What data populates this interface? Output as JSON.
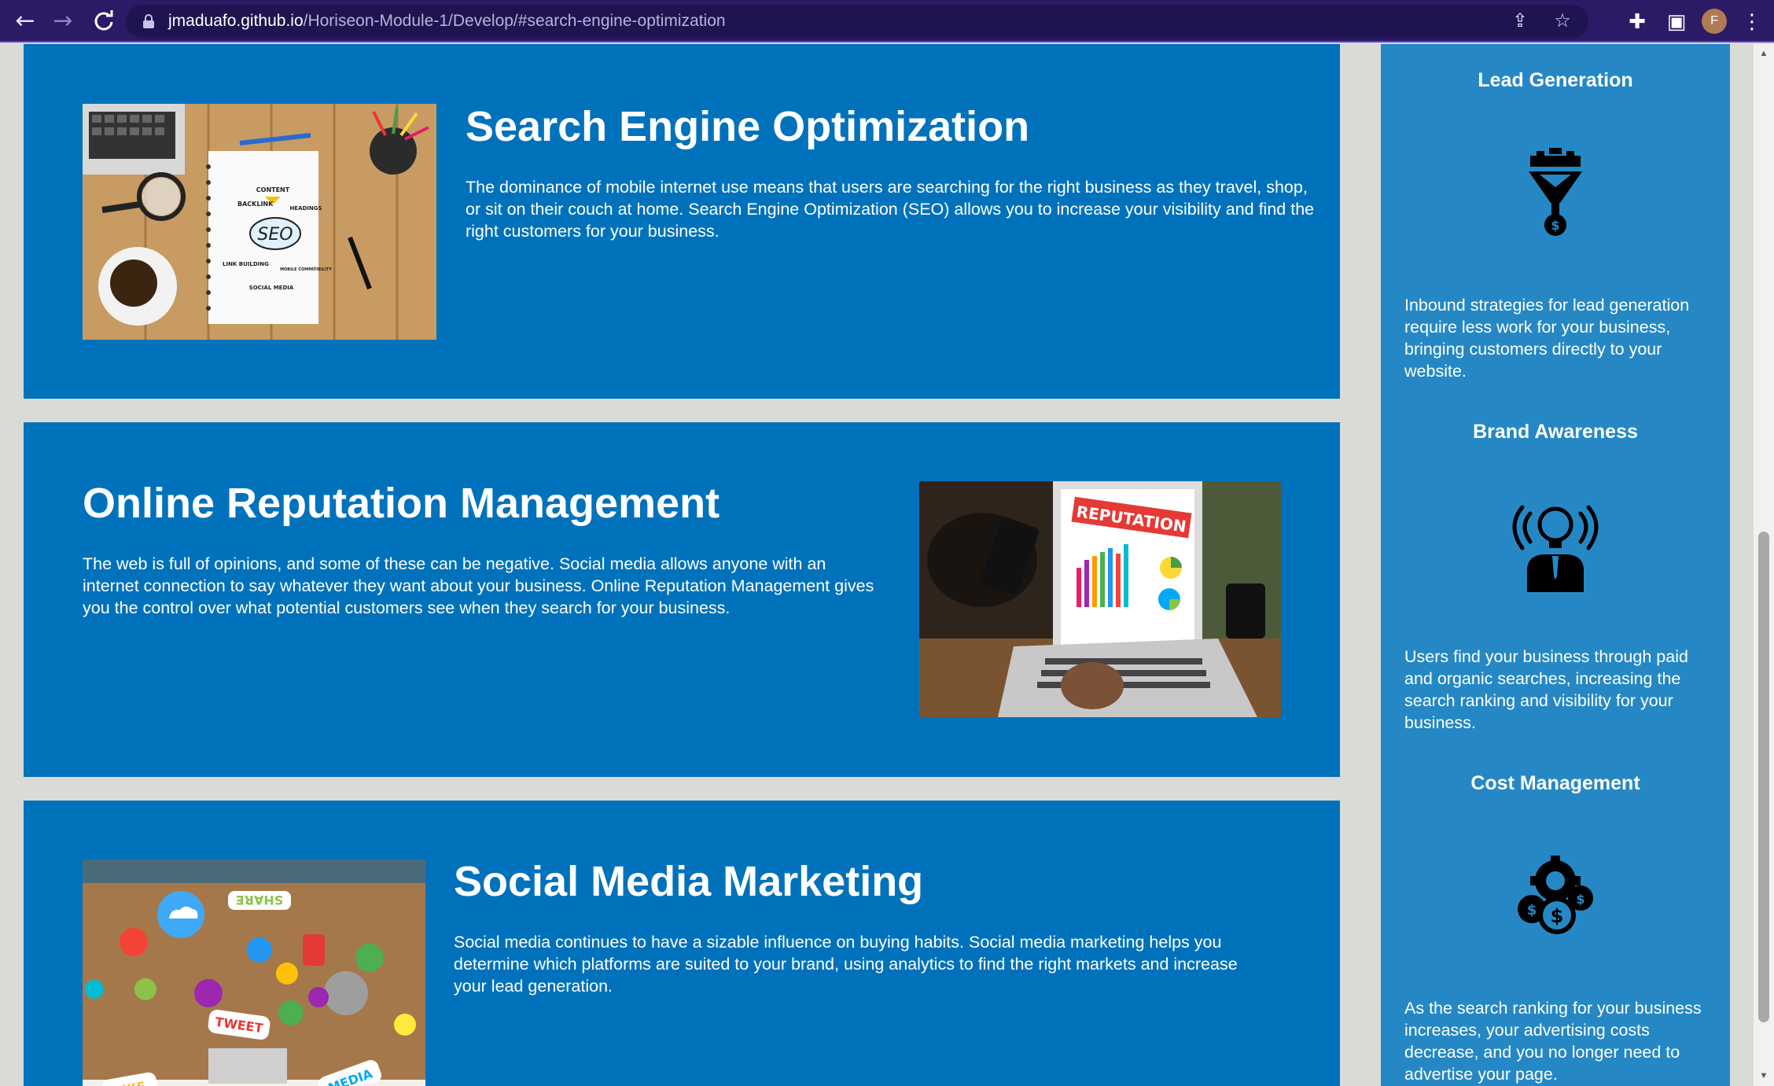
{
  "browser": {
    "url_host": "jmaduafo.github.io",
    "url_path": "/Horiseon-Module-1/Develop/#search-engine-optimization",
    "profile_initial": "F",
    "icons": {
      "back": "arrow-left-icon",
      "forward": "arrow-right-icon",
      "reload": "reload-icon",
      "lock": "lock-icon",
      "share": "share-icon",
      "bookmark": "star-icon",
      "extensions": "puzzle-icon",
      "side_panel": "side-panel-icon",
      "menu": "kebab-menu-icon"
    }
  },
  "sections": {
    "seo": {
      "title": "Search Engine Optimization",
      "text": "The dominance of mobile internet use means that users are searching for the right business as they travel, shop, or sit on their couch at home. Search Engine Optimization (SEO) allows you to increase your visibility and find the right customers for your business.",
      "image_words": [
        "CONTENT",
        "BACKLINK",
        "HEADINGS",
        "SEO",
        "LINK BUILDING",
        "MOBILE COMPATIBILITY",
        "SOCIAL MEDIA"
      ]
    },
    "orm": {
      "title": "Online Reputation Management",
      "text": "The web is full of opinions, and some of these can be negative. Social media allows anyone with an internet connection to say whatever they want about your business. Online Reputation Management gives you the control over what potential customers see when they search for your business.",
      "image_words": [
        "REPUTATION"
      ]
    },
    "smm": {
      "title": "Social Media Marketing",
      "text": "Social media continues to have a sizable influence on buying habits. Social media marketing helps you determine which platforms are suited to your brand, using analytics to find the right markets and increase your lead generation.",
      "image_words": [
        "SHARE",
        "TWEET",
        "LIKE",
        "MEDIA"
      ]
    }
  },
  "benefits": [
    {
      "title": "Lead Generation",
      "icon": "lead-funnel-icon",
      "text": "Inbound strategies for lead generation require less work for your business, bringing customers directly to your website."
    },
    {
      "title": "Brand Awareness",
      "icon": "brand-bulb-icon",
      "text": "Users find your business through paid and organic searches, increasing the search ranking and visibility for your business."
    },
    {
      "title": "Cost Management",
      "icon": "cost-gears-icon",
      "text": "As the search ranking for your business increases, your advertising costs decrease, and you no longer need to advertise your page."
    }
  ],
  "colors": {
    "page_bg": "#d9dcd6",
    "section_bg": "#0072bb",
    "sidebar_bg": "#2588c4",
    "chrome_bg": "#2b1a66",
    "text": "#ffffff"
  }
}
